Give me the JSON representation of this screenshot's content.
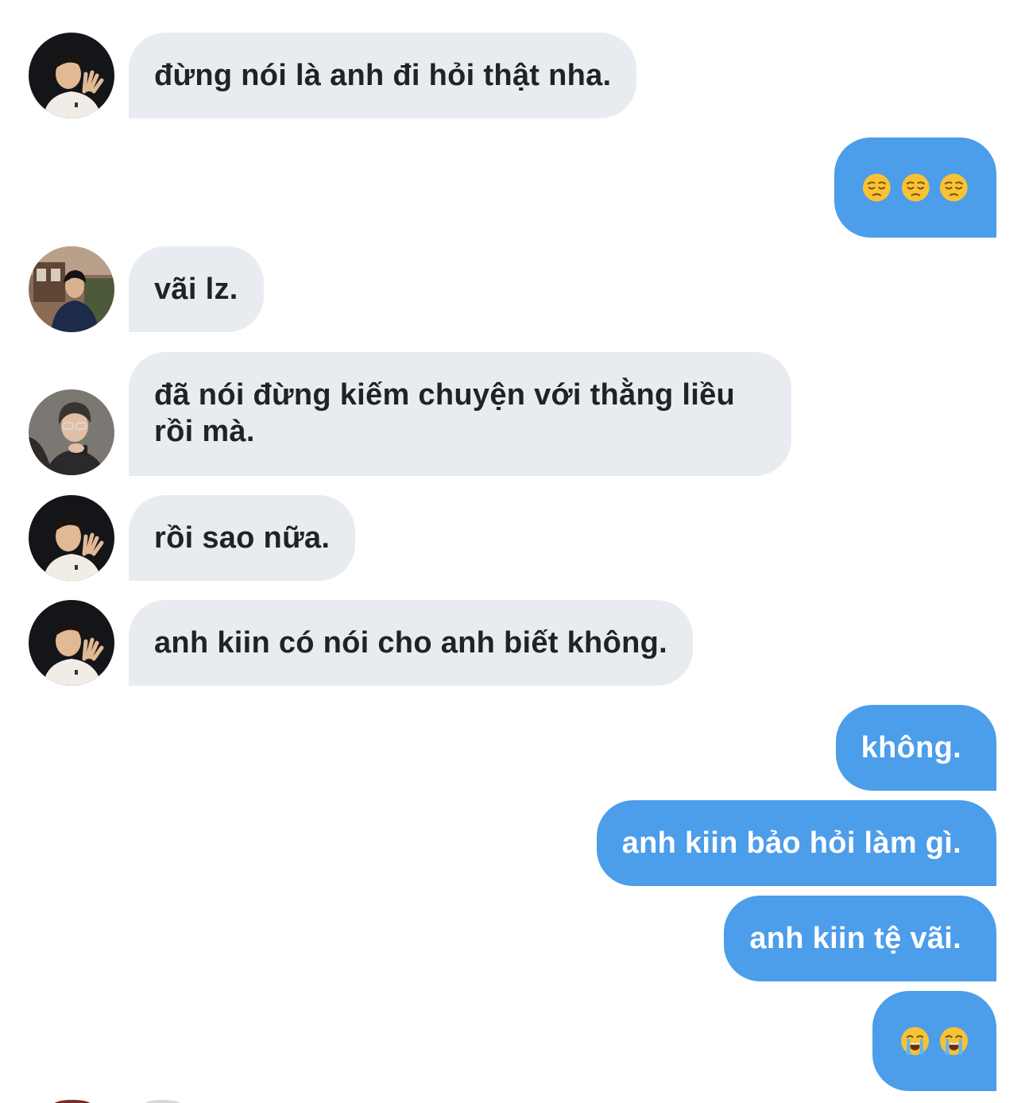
{
  "colors": {
    "incoming_bubble": "#e8ecf0",
    "outgoing_bubble": "#4c9dea",
    "incoming_text": "#1f2227",
    "outgoing_text": "#ffffff"
  },
  "messages": [
    {
      "direction": "in",
      "avatar": "avatar-dark-tee",
      "text": "đừng nói là anh đi hỏi thật nha."
    },
    {
      "direction": "out",
      "emojis": [
        "pensive-face-emoji",
        "pensive-face-emoji",
        "pensive-face-emoji"
      ]
    },
    {
      "direction": "in",
      "avatar": "avatar-street-jacket",
      "text": "vãi lz."
    },
    {
      "direction": "in",
      "avatar": "avatar-glasses",
      "text": "đã nói đừng kiếm chuyện với thằng liều rồi mà."
    },
    {
      "direction": "in",
      "avatar": "avatar-dark-tee",
      "text": "rồi sao nữa."
    },
    {
      "direction": "in",
      "avatar": "avatar-dark-tee",
      "text": "anh kiin có nói cho anh biết không."
    },
    {
      "direction": "out",
      "text": "không."
    },
    {
      "direction": "out",
      "text": "anh kiin bảo hỏi làm gì."
    },
    {
      "direction": "out",
      "text": "anh kiin tệ vãi."
    },
    {
      "direction": "out",
      "emojis": [
        "loudly-crying-face-emoji",
        "loudly-crying-face-emoji"
      ]
    }
  ]
}
